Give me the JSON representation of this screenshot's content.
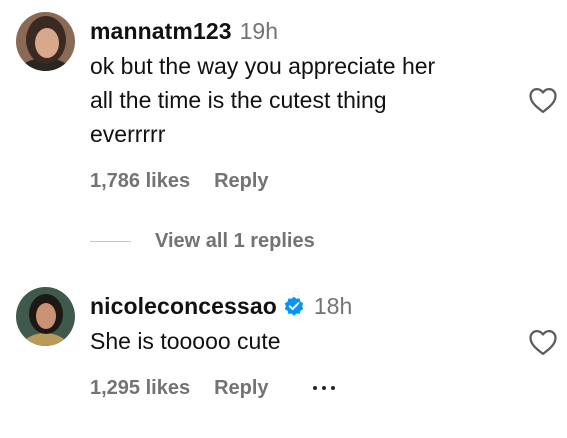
{
  "comments": [
    {
      "username": "mannatm123",
      "timestamp": "19h",
      "text_lines": [
        "ok but the way you appreciate her",
        "all the time is the cutest thing",
        "everrrrr"
      ],
      "likes": "1,786 likes",
      "reply_label": "Reply",
      "avatar_icon": "avatar-photo",
      "like_icon": "heart-outline-icon"
    },
    {
      "username": "nicoleconcessao",
      "verified": true,
      "verified_icon": "verified-badge-icon",
      "timestamp": "18h",
      "text": "She is tooooo cute",
      "likes": "1,295 likes",
      "reply_label": "Reply",
      "avatar_icon": "avatar-photo",
      "like_icon": "heart-outline-icon",
      "more_icon": "more-options-icon"
    }
  ],
  "view_replies": {
    "label": "View all 1 replies"
  },
  "colors": {
    "text": "#111111",
    "muted": "#737373",
    "verified": "#0095f6",
    "divider": "#c7c7c7"
  }
}
